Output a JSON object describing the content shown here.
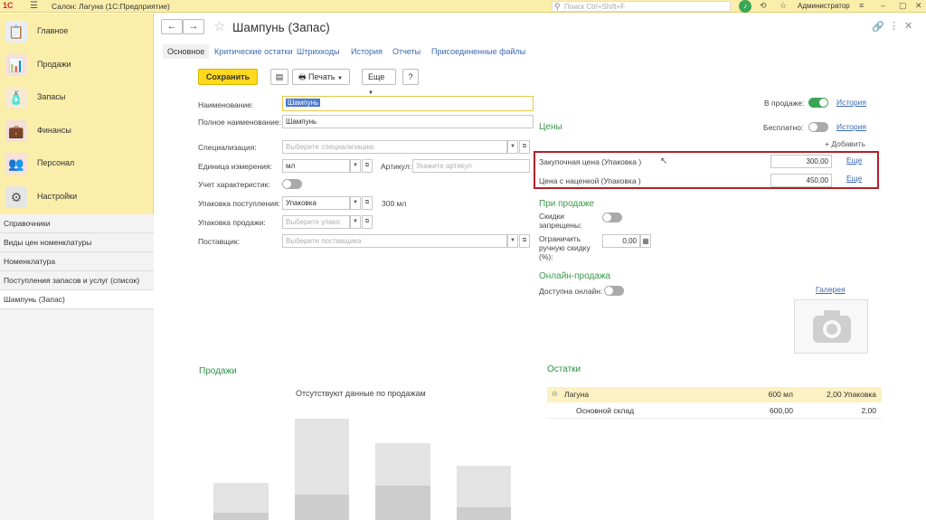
{
  "titlebar": {
    "logo": "1С",
    "menu_icon": "menu-icon",
    "title": "Салон: Лагуна  (1С:Предприятие)",
    "search_placeholder": "Поиск Ctrl+Shift+F",
    "user": "Администратор"
  },
  "sidebar": {
    "sections": [
      {
        "label": "Главное",
        "icon": "clipboard-icon",
        "color": "#3a6fb0"
      },
      {
        "label": "Продажи",
        "icon": "sales-chart-icon",
        "color": "#d14b3a"
      },
      {
        "label": "Запасы",
        "icon": "stock-icon",
        "color": "#e0962a"
      },
      {
        "label": "Финансы",
        "icon": "wallet-icon",
        "color": "#c2512f"
      },
      {
        "label": "Персонал",
        "icon": "staff-icon",
        "color": "#d15a3a"
      },
      {
        "label": "Настройки",
        "icon": "gear-icon",
        "color": "#555555"
      }
    ],
    "nav": [
      "Справочники",
      "Виды цен номенклатуры",
      "Номенклатура",
      "Поступления запасов и услуг (список)",
      "Шампунь (Запас)"
    ]
  },
  "header": {
    "title": "Шампунь (Запас)",
    "back": "←",
    "forward": "→"
  },
  "tabs": [
    "Основное",
    "Критические остатки",
    "Штрихкоды",
    "История",
    "Отчеты",
    "Присоединенные файлы"
  ],
  "toolbar": {
    "save": "Сохранить",
    "print": "Печать",
    "more": "Еще",
    "help": "?"
  },
  "form": {
    "name_label": "Наименование:",
    "name_value": "Шампунь",
    "fullname_label": "Полное наименование:",
    "fullname_value": "Шампунь",
    "spec_label": "Специализация:",
    "spec_placeholder": "Выберите специализацию",
    "unit_label": "Единица измерения:",
    "unit_value": "мл",
    "article_label": "Артикул:",
    "article_placeholder": "Укажите артикул",
    "chars_label": "Учет характеристик:",
    "pack_in_label": "Упаковка поступления:",
    "pack_in_value": "Упаковка",
    "pack_in_volume": "300 мл",
    "pack_sale_label": "Упаковка продажи:",
    "pack_sale_placeholder": "Выберите упако",
    "supplier_label": "Поставщик:",
    "supplier_placeholder": "Выберите поставщика"
  },
  "right": {
    "on_sale_label": "В продаже:",
    "history1": "История",
    "free_label": "Бесплатно:",
    "history2": "История",
    "prices_head": "Цены",
    "add_link": "+ Добавить",
    "purchase_label": "Закупочная цена  (Упаковка )",
    "purchase_value": "300,00",
    "markup_label": "Цена с наценкой  (Упаковка )",
    "markup_value": "450,00",
    "more1": "Еще",
    "more2": "Еще",
    "on_sale_head": "При продаже",
    "discounts_label": "Скидки запрещены:",
    "limit_label": "Ограничить ручную скидку (%):",
    "limit_value": "0,00",
    "online_head": "Онлайн-продажа",
    "online_label": "Доступна онлайн:",
    "gallery": "Галерея"
  },
  "sales": {
    "head": "Продажи",
    "empty": "Отсутствуют данные по продажам"
  },
  "stock": {
    "head": "Остатки",
    "rows": [
      {
        "name": "Лагуна",
        "qty": "600 мл",
        "pack": "2,00 Упаковка"
      },
      {
        "name": "Основной склад",
        "qty": "600,00",
        "pack": "2,00"
      }
    ]
  },
  "colors": {
    "accent_yellow": "#fbeeaa",
    "save_button": "#ffd91e",
    "highlight_border": "#b3202a",
    "link": "#3b6ab2",
    "green": "#3aa655"
  }
}
